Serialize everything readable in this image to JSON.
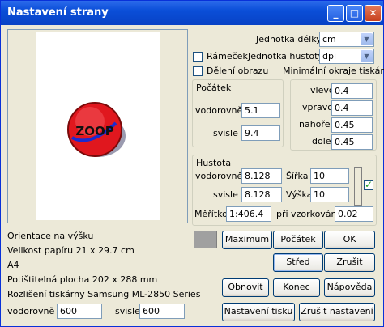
{
  "window": {
    "title": "Nastavení strany"
  },
  "units": {
    "label": "Jednotka délky",
    "value": "cm"
  },
  "frame": {
    "label": "Rámeček",
    "checked": false
  },
  "density_unit": {
    "label": "Jednotka hustoty",
    "value": "dpi"
  },
  "split": {
    "label": "Dělení obrazu",
    "checked": false
  },
  "min_margins_label": "Minimální okraje tiskárny",
  "origin": {
    "title": "Počátek",
    "h_label": "vodorovně",
    "h_value": "5.1",
    "v_label": "svisle",
    "v_value": "9.4"
  },
  "margins": {
    "left_label": "vlevo",
    "left": "0.4",
    "right_label": "vpravo",
    "right": "0.4",
    "top_label": "nahoře",
    "top": "0.45",
    "bottom_label": "dole",
    "bottom": "0.45"
  },
  "density": {
    "title": "Hustota",
    "h_label": "vodorovně",
    "h_value": "8.128",
    "v_label": "svisle",
    "v_value": "8.128",
    "width_label": "Šířka",
    "width": "10",
    "height_label": "Výška",
    "height": "10",
    "linked": true
  },
  "scale": {
    "label": "Měřítko",
    "value": "1:406.4",
    "sampling_label": "při vzorkování",
    "sampling": "0.02"
  },
  "preview": {
    "logo_text": "ZOOP"
  },
  "info": {
    "orientation_label": "Orientace",
    "orientation": "na výšku",
    "paper_label": "Velikost papíru",
    "paper": "21 x 29.7 cm",
    "paper_name": "A4",
    "printable_label": "Potištitelná plocha",
    "printable": "202 x 288 mm",
    "resolution_label": "Rozlišení tiskárny",
    "printer": "Samsung ML-2850 Series",
    "res_h_label": "vodorovně",
    "res_h": "600",
    "res_v_label": "svisle",
    "res_v": "600"
  },
  "buttons": {
    "maximum": "Maximum",
    "origin": "Počátek",
    "ok": "OK",
    "center": "Střed",
    "cancel": "Zrušit",
    "restore": "Obnovit",
    "end": "Konec",
    "help": "Nápověda",
    "print_setup": "Nastavení tisku",
    "cancel_setup": "Zrušit nastavení"
  },
  "colors": {
    "titlebar": "#0A4ED8",
    "face": "#ECE9D8",
    "swatch": "#A0A0A0"
  }
}
